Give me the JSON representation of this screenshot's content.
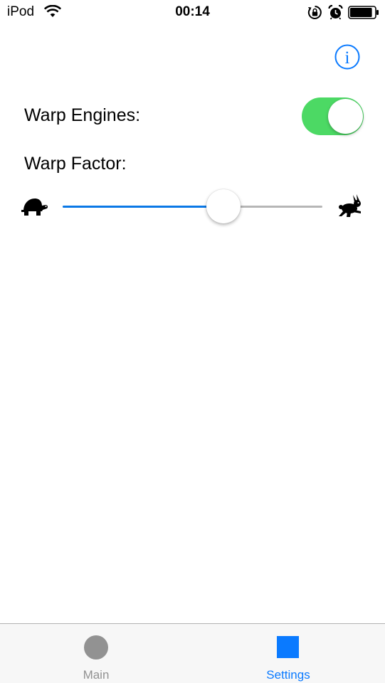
{
  "status_bar": {
    "carrier": "iPod",
    "time": "00:14",
    "wifi_icon": "wifi-icon",
    "rotation_lock_icon": "rotation-lock-icon",
    "alarm_icon": "alarm-icon",
    "battery_icon": "battery-icon",
    "battery_level": 0.9
  },
  "settings": {
    "info_icon": "info-icon",
    "warp_engines_label": "Warp Engines:",
    "warp_engines_on": true,
    "warp_factor_label": "Warp Factor:",
    "warp_factor_value": 0.62,
    "slow_icon": "turtle-icon",
    "fast_icon": "rabbit-icon"
  },
  "tab_bar": {
    "tabs": [
      {
        "label": "Main",
        "icon": "circle-icon",
        "selected": false
      },
      {
        "label": "Settings",
        "icon": "square-icon",
        "selected": true
      }
    ]
  },
  "colors": {
    "accent": "#0a7aff",
    "slider_fill": "#0a78e6",
    "toggle_on": "#4cd964",
    "inactive_tab": "#929292"
  }
}
